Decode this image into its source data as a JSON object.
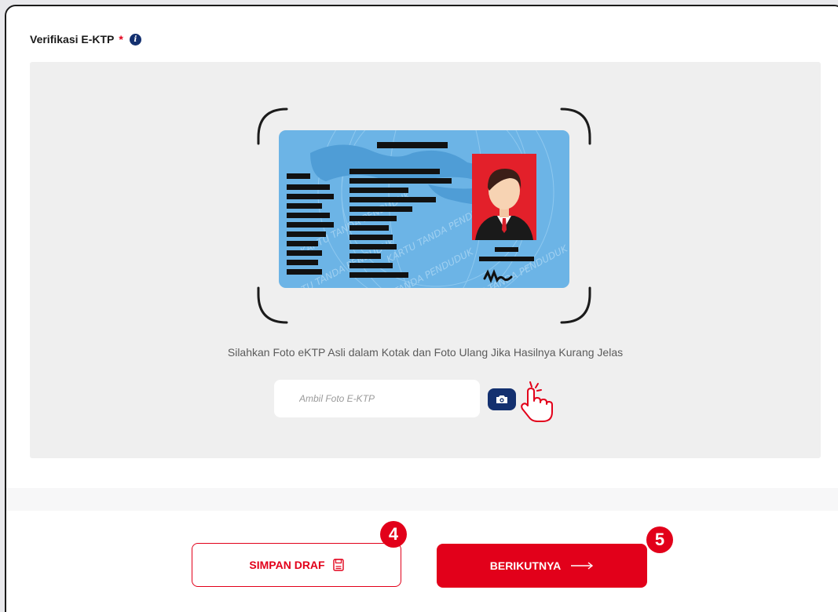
{
  "section": {
    "title": "Verifikasi E-KTP",
    "required_mark": "*",
    "info_icon": "info-icon"
  },
  "ktp": {
    "instruction": "Silahkan Foto eKTP Asli dalam Kotak dan Foto Ulang Jika Hasilnya Kurang Jelas",
    "input_placeholder": "Ambil Foto E-KTP",
    "camera_icon": "camera-icon",
    "card_watermark": "KARTU TANDA PENDUDUK"
  },
  "footer": {
    "draft_label": "SIMPAN DRAF",
    "draft_icon": "save-icon",
    "next_label": "BERIKUTNYA",
    "next_icon": "arrow-right-icon"
  },
  "steps": {
    "draft": "4",
    "next": "5"
  },
  "colors": {
    "primary_red": "#e2001a",
    "navy": "#13306f",
    "card_blue": "#6cb4e6",
    "photo_bg": "#e3202a"
  }
}
